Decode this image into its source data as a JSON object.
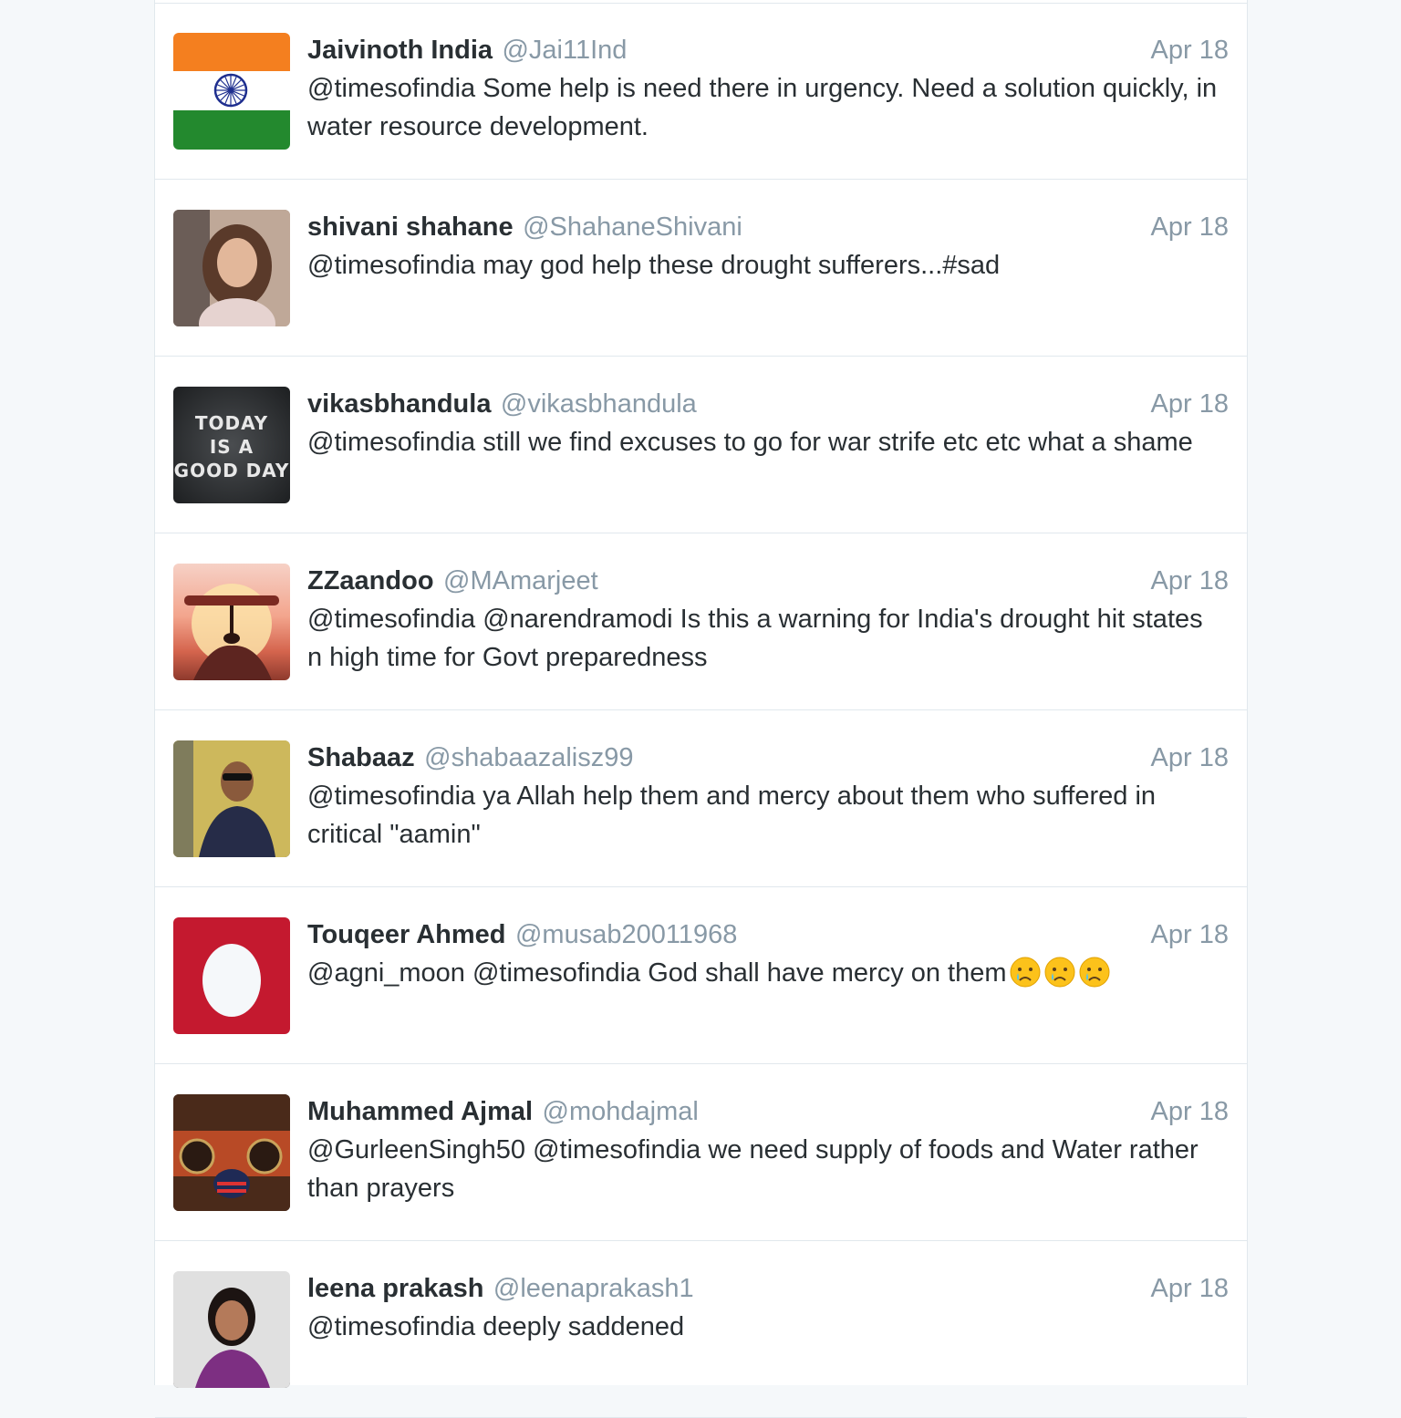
{
  "tweets": [
    {
      "name": "Jaivinoth India",
      "handle": "@Jai11Ind",
      "date": "Apr 18",
      "text": "@timesofindia  Some help is need there in urgency. Need a solution quickly, in water resource development.",
      "avatar": "indian-flag"
    },
    {
      "name": "shivani shahane",
      "handle": "@ShahaneShivani",
      "date": "Apr 18",
      "text": "@timesofindia may god help these drought sufferers...#sad",
      "avatar": "profile-photo"
    },
    {
      "name": "vikasbhandula",
      "handle": "@vikasbhandula",
      "date": "Apr 18",
      "text": "@timesofindia still we find excuses to go for war strife etc etc what a shame",
      "avatar": "text-image",
      "avatar_text": [
        "TODAY",
        "IS A",
        "GOOD DAY"
      ]
    },
    {
      "name": "ZZaandoo",
      "handle": "@MAmarjeet",
      "date": "Apr 18",
      "text": "@timesofindia @narendramodi Is this a warning for India's drought hit states n high time for Govt preparedness",
      "avatar": "ant-sunset"
    },
    {
      "name": "Shabaaz",
      "handle": "@shabaazalisz99",
      "date": "Apr 18",
      "text": "@timesofindia ya Allah help them and mercy about them who suffered in critical \"aamin\"",
      "avatar": "profile-photo"
    },
    {
      "name": "Touqeer Ahmed",
      "handle": "@musab20011968",
      "date": "Apr 18",
      "text": "@agni_moon @timesofindia God shall have mercy on them",
      "emoji": [
        "crying-face-icon",
        "crying-face-icon",
        "crying-face-icon"
      ],
      "avatar": "default-egg"
    },
    {
      "name": "Muhammed Ajmal",
      "handle": "@mohdajmal",
      "date": "Apr 18",
      "text": "@GurleenSingh50 @timesofindia we need supply of foods and Water rather than prayers",
      "avatar": "motorcycles"
    },
    {
      "name": "leena prakash",
      "handle": "@leenaprakash1",
      "date": "Apr 18",
      "text": "@timesofindia deeply saddened",
      "avatar": "profile-photo"
    }
  ],
  "colors": {
    "page_background": "#f5f8fa",
    "name": "#292f33",
    "meta": "#8899a6",
    "divider": "#e1e8ed"
  }
}
